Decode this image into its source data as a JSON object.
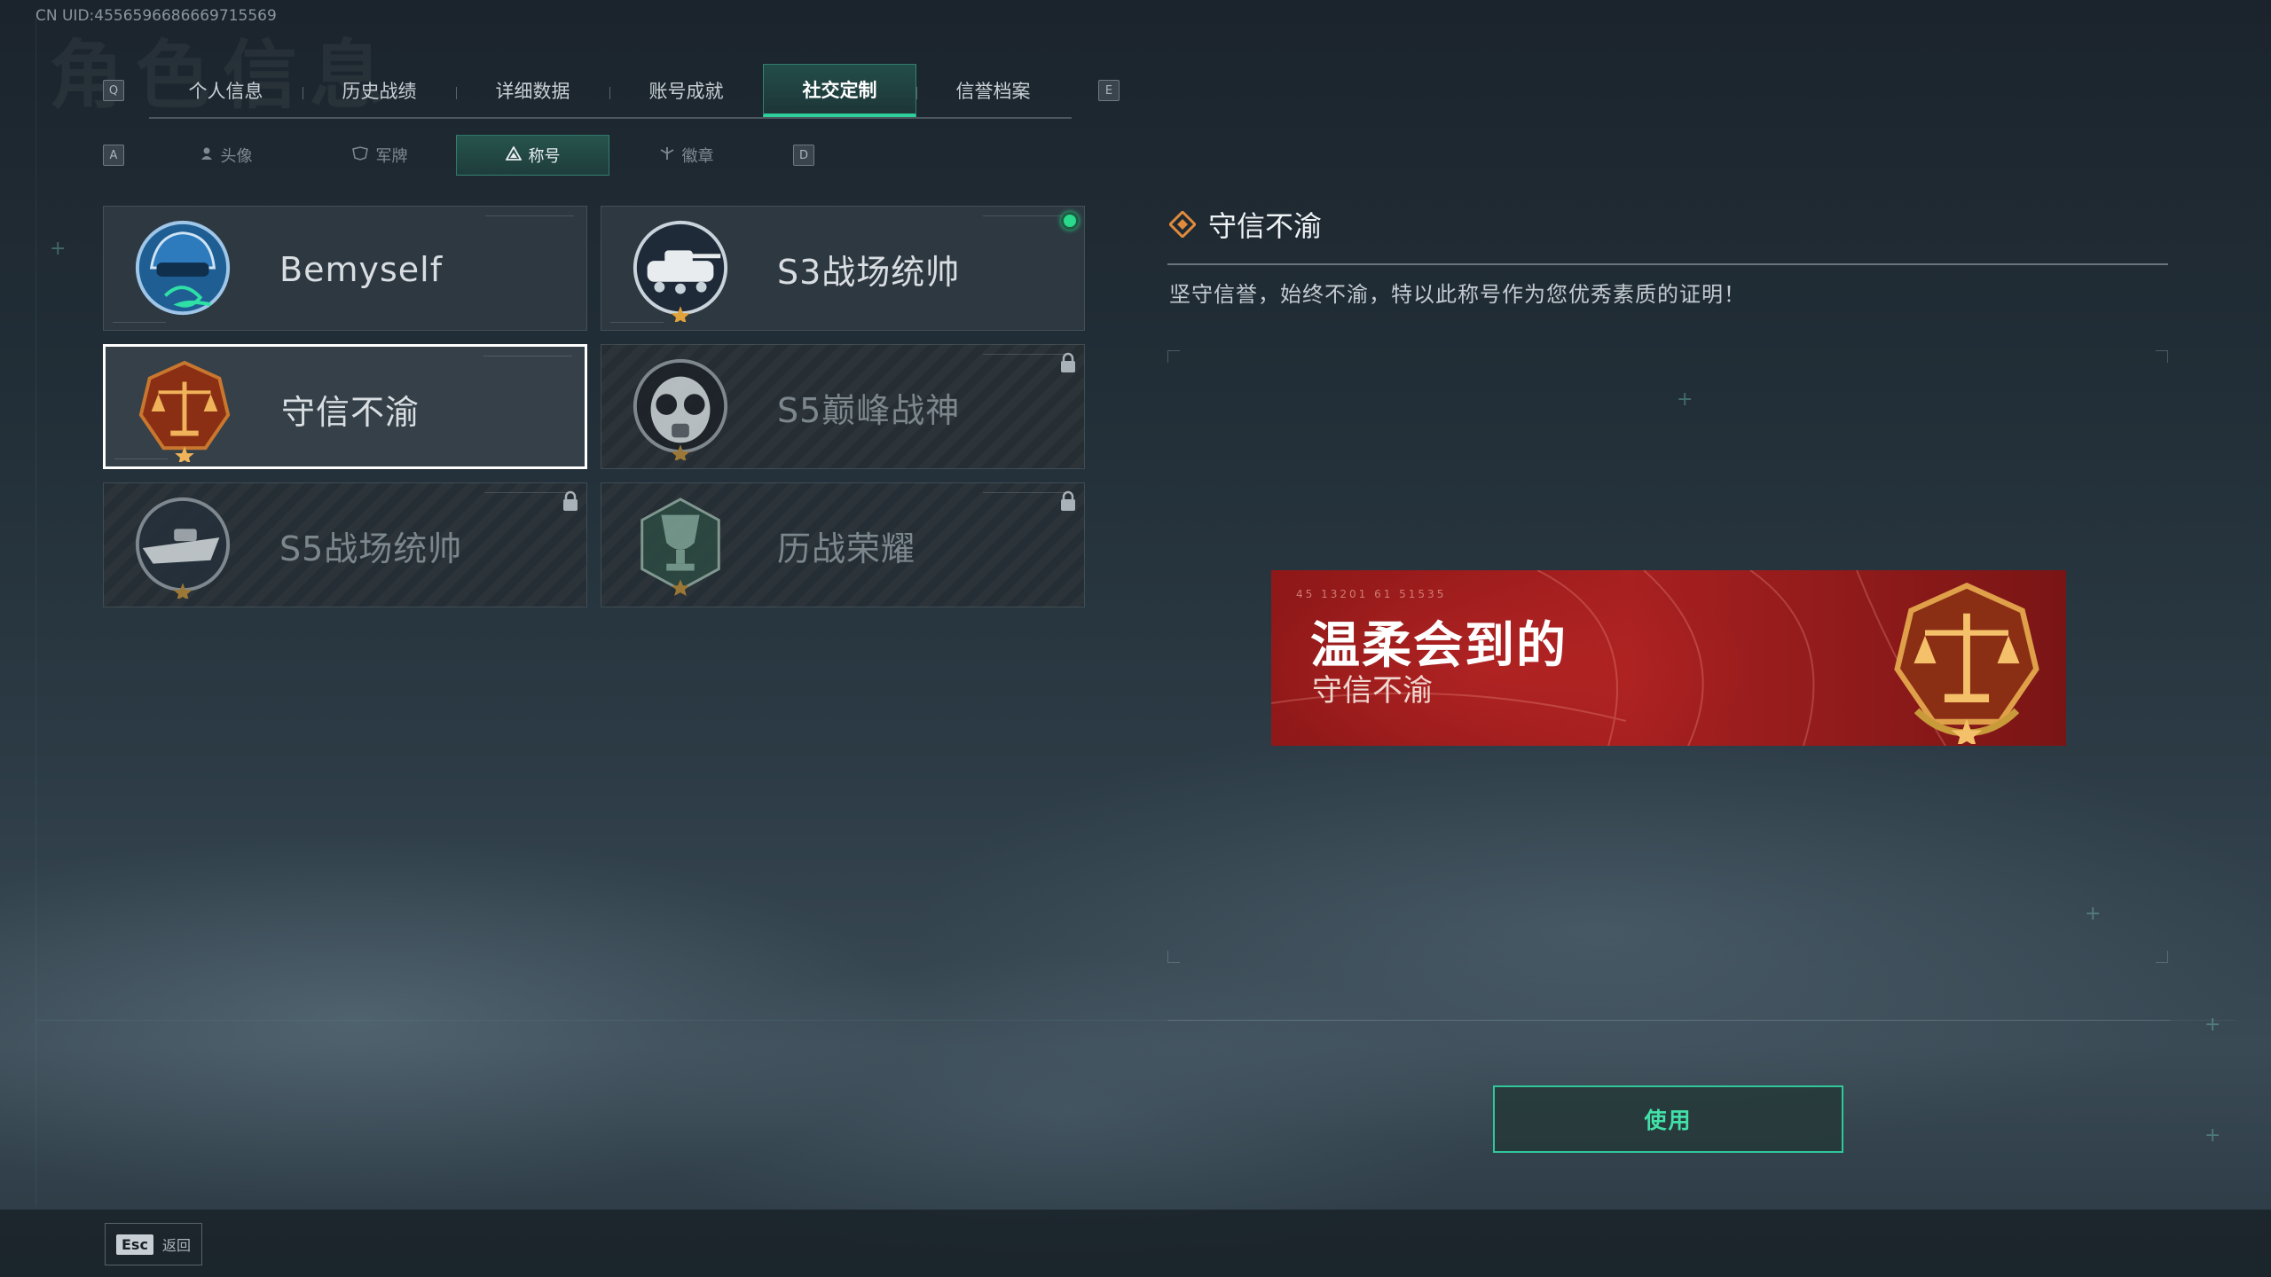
{
  "header": {
    "uid": "CN UID:4556596686669715569",
    "bg_title": "角色信息",
    "prev_key": "Q",
    "next_key": "E"
  },
  "main_tabs": [
    {
      "label": "个人信息",
      "active": false
    },
    {
      "label": "历史战绩",
      "active": false
    },
    {
      "label": "详细数据",
      "active": false
    },
    {
      "label": "账号成就",
      "active": false
    },
    {
      "label": "社交定制",
      "active": true
    },
    {
      "label": "信誉档案",
      "active": false
    }
  ],
  "sub_tabs": {
    "prev_key": "A",
    "next_key": "D",
    "items": [
      {
        "label": "头像",
        "icon": "person-icon",
        "active": false
      },
      {
        "label": "军牌",
        "icon": "dogtag-icon",
        "active": false
      },
      {
        "label": "称号",
        "icon": "title-icon",
        "active": true
      },
      {
        "label": "徽章",
        "icon": "emblem-icon",
        "active": false
      }
    ]
  },
  "titles": [
    {
      "name": "Bemyself",
      "badge": "helmet-signature-badge",
      "locked": false,
      "equipped": false,
      "selected": false
    },
    {
      "name": "S3战场统帅",
      "badge": "tank-badge",
      "locked": false,
      "equipped": true,
      "selected": false
    },
    {
      "name": "守信不渝",
      "badge": "scales-badge",
      "locked": false,
      "equipped": false,
      "selected": true
    },
    {
      "name": "S5巅峰战神",
      "badge": "gasmask-badge",
      "locked": true,
      "equipped": false,
      "selected": false
    },
    {
      "name": "S5战场统帅",
      "badge": "boat-badge",
      "locked": true,
      "equipped": false,
      "selected": false
    },
    {
      "name": "历战荣耀",
      "badge": "trophy-badge",
      "locked": true,
      "equipped": false,
      "selected": false
    }
  ],
  "detail": {
    "title": "守信不渝",
    "description": "坚守信誉，始终不渝，特以此称号作为您优秀素质的证明！"
  },
  "banner": {
    "player_name": "温柔会到的",
    "title_name": "守信不渝",
    "deco_numbers": "45 13201  61 51535",
    "accent_color": "#a82020"
  },
  "actions": {
    "use_label": "使用"
  },
  "footer": {
    "esc_key": "Esc",
    "back_label": "返回"
  },
  "colors": {
    "accent_green": "#2fcf9b",
    "equipped_dot": "#29d98c"
  }
}
